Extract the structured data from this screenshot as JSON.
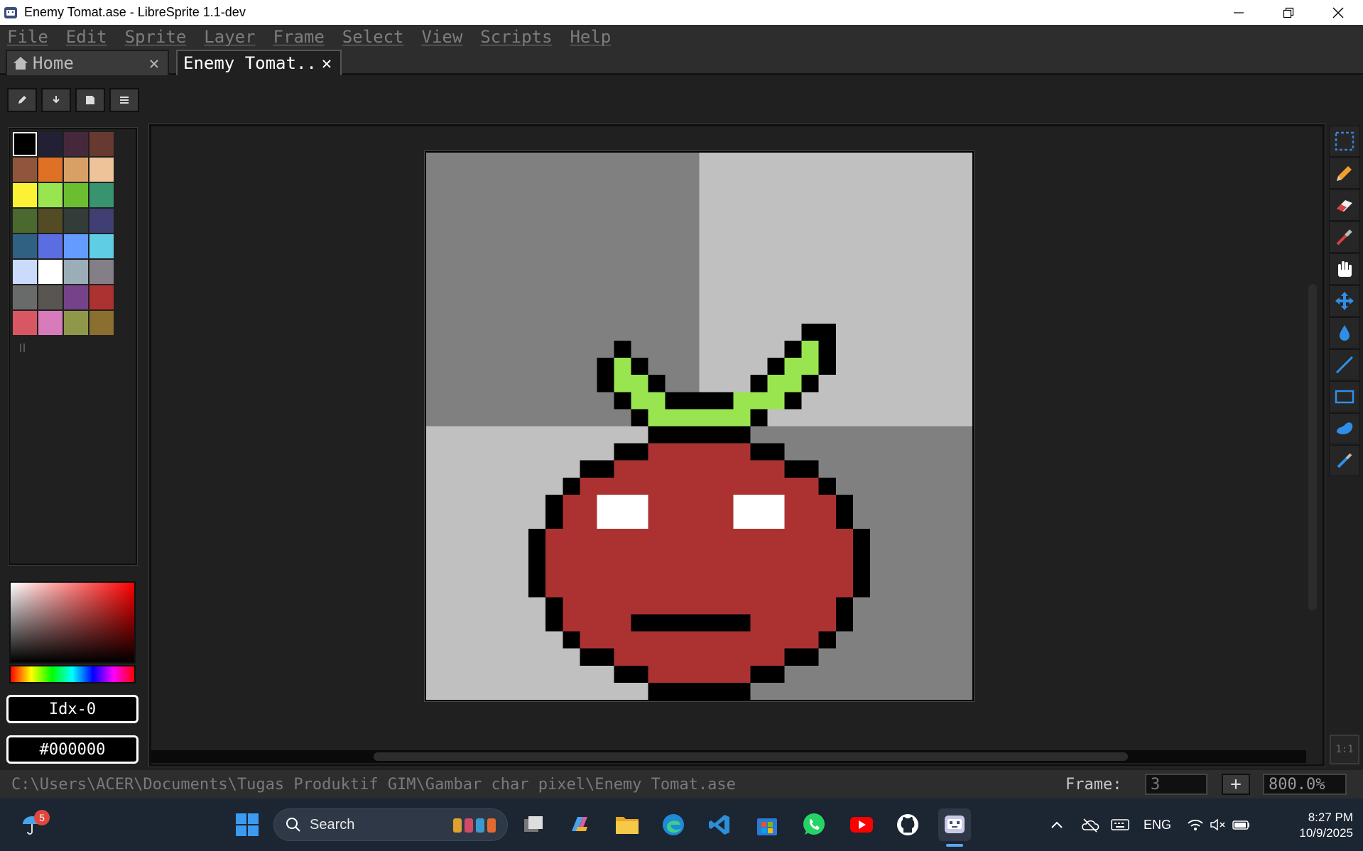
{
  "window": {
    "title": "Enemy Tomat.ase - LibreSprite 1.1-dev"
  },
  "menu": [
    "File",
    "Edit",
    "Sprite",
    "Layer",
    "Frame",
    "Select",
    "View",
    "Scripts",
    "Help"
  ],
  "tabs": {
    "home": {
      "label": "Home",
      "close": "✕"
    },
    "active": {
      "label": "Enemy Tomat..",
      "close": "✕"
    }
  },
  "toolbar_icons": [
    "edit-icon",
    "download-icon",
    "save-icon",
    "menu-icon"
  ],
  "palette": [
    "#000000",
    "#222034",
    "#45283c",
    "#663931",
    "#8f563b",
    "#df7126",
    "#d9a066",
    "#eec39a",
    "#fbf236",
    "#99e550",
    "#6abe30",
    "#37946e",
    "#4b692f",
    "#524b24",
    "#323c39",
    "#3f3f74",
    "#306082",
    "#5b6ee1",
    "#639bff",
    "#5fcde4",
    "#cbdbfc",
    "#ffffff",
    "#9badb7",
    "#847e87",
    "#696a6a",
    "#595652",
    "#76428a",
    "#ac3232",
    "#d95763",
    "#d77bba",
    "#8f974a",
    "#8a6f30"
  ],
  "color": {
    "index": "Idx-0",
    "hex": "#000000"
  },
  "right_tools": [
    "marquee-icon",
    "pencil-icon",
    "eraser-icon",
    "eyedropper-icon",
    "hand-icon",
    "move-icon",
    "bucket-icon",
    "line-icon",
    "rectangle-icon",
    "blob-icon",
    "spray-icon"
  ],
  "ratio": "1:1",
  "status": {
    "path": "C:\\Users\\ACER\\Documents\\Tugas Produktif GIM\\Gambar char pixel\\Enemy Tomat.ase",
    "frame_label": "Frame:",
    "frame_value": "3",
    "plus": "+",
    "zoom": "800.0%"
  },
  "taskbar": {
    "weather_badge": "5",
    "search_label": "Search",
    "lang": "ENG",
    "time": "8:27 PM",
    "date": "10/9/2025"
  },
  "sprite": {
    "colors": {
      "outline": "#000000",
      "leaf": "#99e550",
      "body": "#ac3232",
      "eyes": "#ffffff"
    }
  }
}
